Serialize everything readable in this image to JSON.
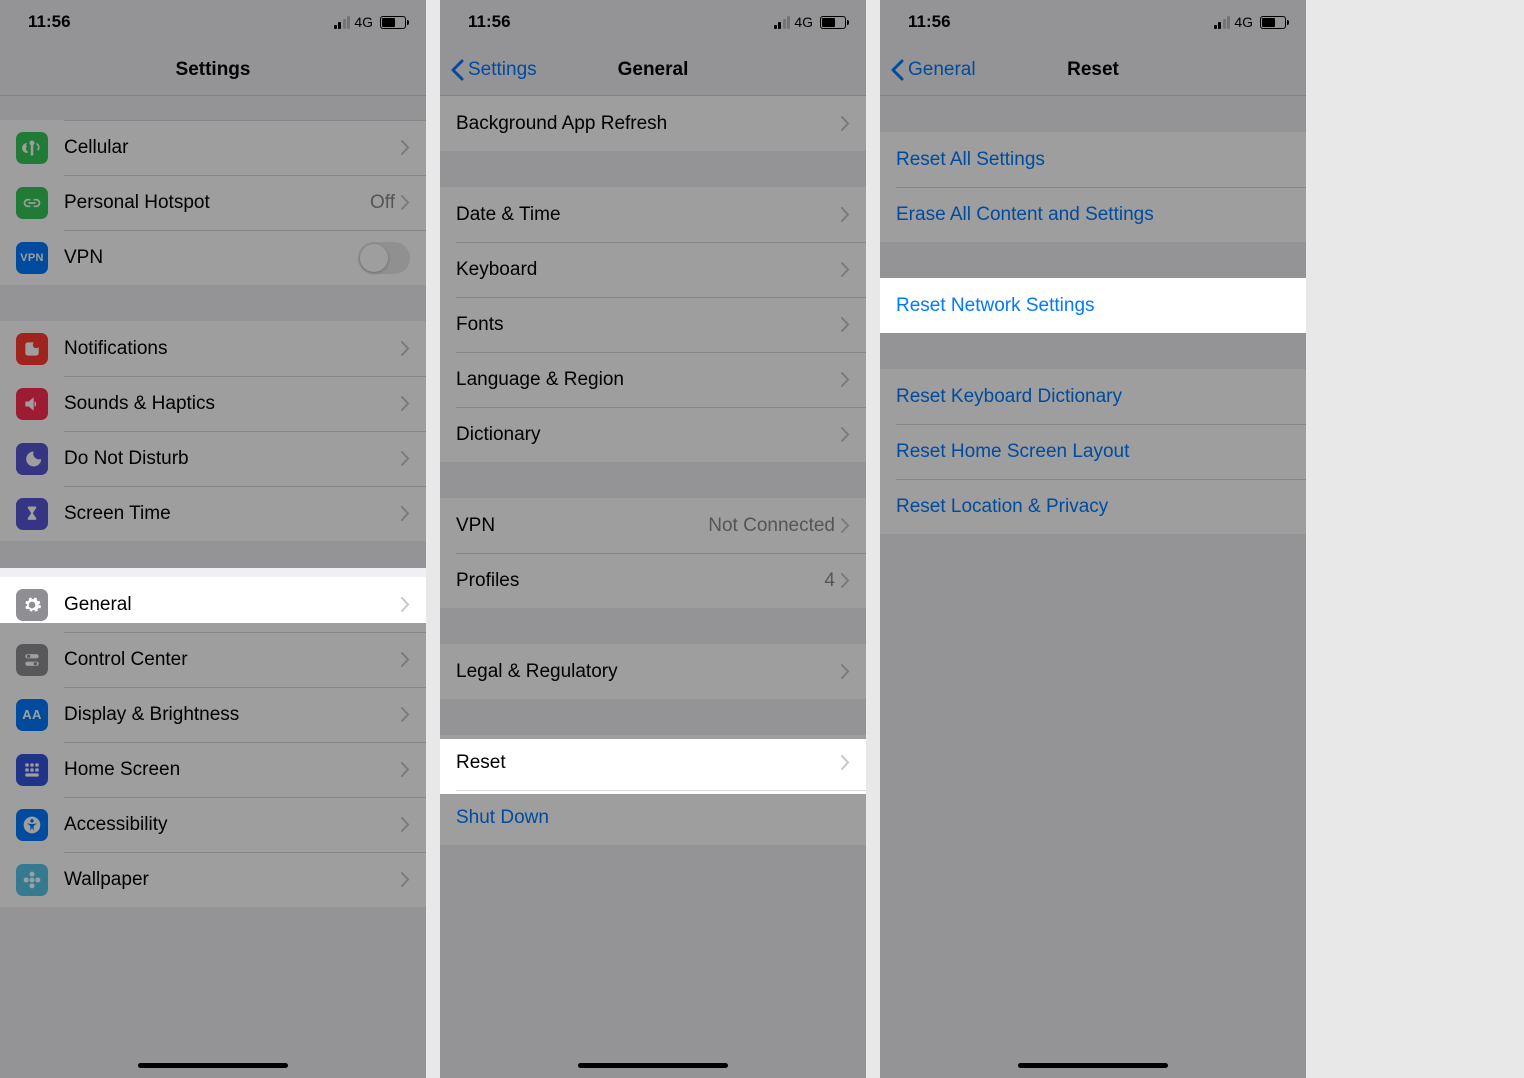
{
  "status": {
    "time": "11:56",
    "network": "4G"
  },
  "screen1": {
    "title": "Settings",
    "rows": {
      "cellular": "Cellular",
      "hotspot": "Personal Hotspot",
      "hotspot_value": "Off",
      "vpn": "VPN",
      "notifications": "Notifications",
      "sounds": "Sounds & Haptics",
      "dnd": "Do Not Disturb",
      "screentime": "Screen Time",
      "general": "General",
      "controlcenter": "Control Center",
      "display": "Display & Brightness",
      "homescreen": "Home Screen",
      "accessibility": "Accessibility",
      "wallpaper": "Wallpaper"
    }
  },
  "screen2": {
    "back": "Settings",
    "title": "General",
    "rows": {
      "bg_refresh": "Background App Refresh",
      "date_time": "Date & Time",
      "keyboard": "Keyboard",
      "fonts": "Fonts",
      "lang_region": "Language & Region",
      "dictionary": "Dictionary",
      "vpn": "VPN",
      "vpn_value": "Not Connected",
      "profiles": "Profiles",
      "profiles_value": "4",
      "legal": "Legal & Regulatory",
      "reset": "Reset",
      "shutdown": "Shut Down"
    }
  },
  "screen3": {
    "back": "General",
    "title": "Reset",
    "rows": {
      "reset_all": "Reset All Settings",
      "erase_all": "Erase All Content and Settings",
      "reset_network": "Reset Network Settings",
      "reset_keyboard": "Reset Keyboard Dictionary",
      "reset_home": "Reset Home Screen Layout",
      "reset_location": "Reset Location & Privacy"
    }
  }
}
